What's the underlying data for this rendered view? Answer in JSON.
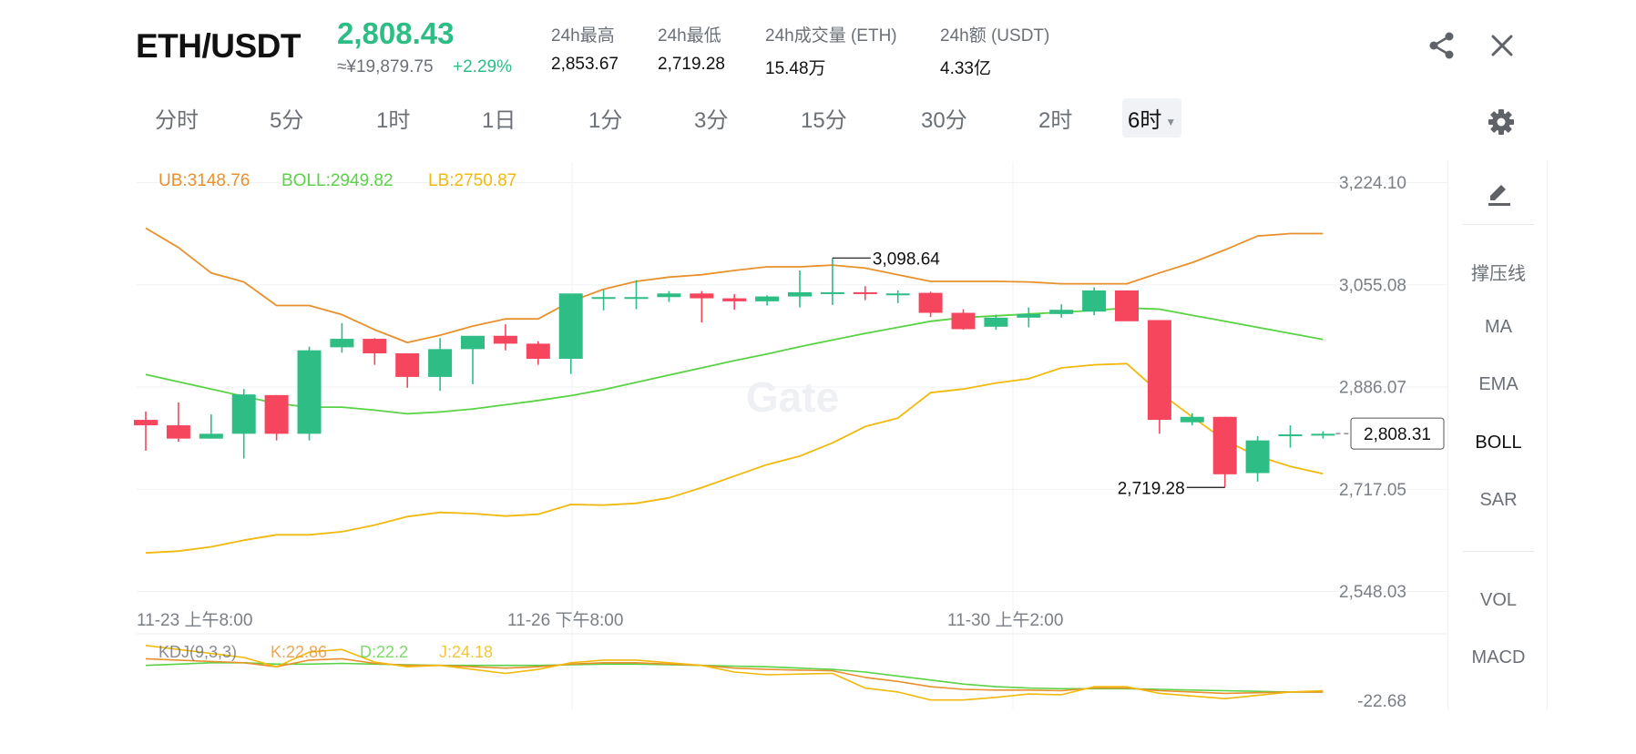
{
  "header": {
    "pair": "ETH/USDT",
    "price": "2,808.43",
    "price_cny": "≈¥19,879.75",
    "change": "+2.29%",
    "stats": [
      {
        "label": "24h最高",
        "value": "2,853.67"
      },
      {
        "label": "24h最低",
        "value": "2,719.28"
      },
      {
        "label": "24h成交量 (ETH)",
        "value": "15.48万"
      },
      {
        "label": "24h额 (USDT)",
        "value": "4.33亿"
      }
    ],
    "share_icon": "share-icon",
    "close_icon": "close-icon"
  },
  "timeframes": [
    "分时",
    "5分",
    "1时",
    "1日",
    "1分",
    "3分",
    "15分",
    "30分",
    "2时",
    "6时"
  ],
  "active_timeframe": "6时",
  "settings_icon": "gear-icon",
  "indicator_legend": {
    "ub": "UB:3148.76",
    "boll": "BOLL:2949.82",
    "lb": "LB:2750.87"
  },
  "kdj_legend": {
    "name": "KDJ(9,3,3)",
    "k": "K:22.86",
    "d": "D:22.2",
    "j": "J:24.18"
  },
  "sidebar": {
    "draw_icon": "pencil-icon",
    "items": [
      "撑压线",
      "MA",
      "EMA",
      "BOLL",
      "SAR"
    ],
    "active": "BOLL",
    "sub_items": [
      "VOL",
      "MACD"
    ]
  },
  "colors": {
    "up": "#2dbd85",
    "down": "#f6465d",
    "ub": "#e8912c",
    "boll": "#59d245",
    "lb": "#f0b90b",
    "kdj_k": "#e8912c",
    "kdj_d": "#59d245",
    "kdj_j": "#f0b90b"
  },
  "chart_data": {
    "type": "candlestick",
    "y_ticks": [
      "3,224.10",
      "3,055.08",
      "2,886.07",
      "2,717.05",
      "2,548.03"
    ],
    "ylim": [
      2548.03,
      3224.1
    ],
    "x_tick_labels": [
      "11-23 上午8:00",
      "11-26 下午8:00",
      "11-30 上午2:00"
    ],
    "last_price_label": "2,808.31",
    "last_price": 2808.31,
    "high_marker": {
      "label": "3,098.64",
      "value": 3098.64
    },
    "low_marker": {
      "label": "2,719.28",
      "value": 2719.28
    },
    "kdj_axis_label": "-22.68",
    "candles": [
      {
        "o": 2831,
        "h": 2845,
        "l": 2780,
        "c": 2822
      },
      {
        "o": 2822,
        "h": 2860,
        "l": 2795,
        "c": 2800
      },
      {
        "o": 2800,
        "h": 2840,
        "l": 2800,
        "c": 2808
      },
      {
        "o": 2808,
        "h": 2882,
        "l": 2767,
        "c": 2873
      },
      {
        "o": 2872,
        "h": 2872,
        "l": 2797,
        "c": 2808
      },
      {
        "o": 2808,
        "h": 2952,
        "l": 2797,
        "c": 2946
      },
      {
        "o": 2951,
        "h": 2991,
        "l": 2942,
        "c": 2965
      },
      {
        "o": 2965,
        "h": 2966,
        "l": 2922,
        "c": 2941
      },
      {
        "o": 2941,
        "h": 2941,
        "l": 2884,
        "c": 2902
      },
      {
        "o": 2902,
        "h": 2966,
        "l": 2879,
        "c": 2948
      },
      {
        "o": 2948,
        "h": 2966,
        "l": 2890,
        "c": 2970
      },
      {
        "o": 2970,
        "h": 2989,
        "l": 2946,
        "c": 2957
      },
      {
        "o": 2957,
        "h": 2961,
        "l": 2922,
        "c": 2932
      },
      {
        "o": 2932,
        "h": 3030,
        "l": 2907,
        "c": 3040
      },
      {
        "o": 3034,
        "h": 3046,
        "l": 3012,
        "c": 3034
      },
      {
        "o": 3034,
        "h": 3062,
        "l": 3014,
        "c": 3034
      },
      {
        "o": 3034,
        "h": 3044,
        "l": 3026,
        "c": 3040
      },
      {
        "o": 3040,
        "h": 3044,
        "l": 2992,
        "c": 3032
      },
      {
        "o": 3032,
        "h": 3039,
        "l": 3013,
        "c": 3027
      },
      {
        "o": 3027,
        "h": 3037,
        "l": 3020,
        "c": 3035
      },
      {
        "o": 3035,
        "h": 3078,
        "l": 3017,
        "c": 3042
      },
      {
        "o": 3042,
        "h": 3098.64,
        "l": 3021,
        "c": 3042
      },
      {
        "o": 3042,
        "h": 3052,
        "l": 3029,
        "c": 3040
      },
      {
        "o": 3040,
        "h": 3045,
        "l": 3024,
        "c": 3040
      },
      {
        "o": 3041,
        "h": 3043,
        "l": 3001,
        "c": 3008
      },
      {
        "o": 3008,
        "h": 3014,
        "l": 2980,
        "c": 2981
      },
      {
        "o": 2985,
        "h": 3005,
        "l": 2980,
        "c": 3000
      },
      {
        "o": 3000,
        "h": 3017,
        "l": 2984,
        "c": 3006
      },
      {
        "o": 3006,
        "h": 3022,
        "l": 3000,
        "c": 3013
      },
      {
        "o": 3010,
        "h": 3050,
        "l": 3004,
        "c": 3045
      },
      {
        "o": 3045,
        "h": 3045,
        "l": 3000,
        "c": 2994
      },
      {
        "o": 2996,
        "h": 2996,
        "l": 2808,
        "c": 2831
      },
      {
        "o": 2827,
        "h": 2842,
        "l": 2822,
        "c": 2836
      },
      {
        "o": 2836,
        "h": 2836,
        "l": 2719.28,
        "c": 2741
      },
      {
        "o": 2743,
        "h": 2804,
        "l": 2729,
        "c": 2797
      },
      {
        "o": 2806,
        "h": 2822,
        "l": 2785,
        "c": 2807
      },
      {
        "o": 2806,
        "h": 2812,
        "l": 2800,
        "c": 2808
      }
    ],
    "ub": [
      3148,
      3116,
      3074,
      3059,
      3020,
      3020,
      3005,
      2980,
      2959,
      2971,
      2986,
      2998,
      2998,
      3027,
      3047,
      3060,
      3067,
      3071,
      3078,
      3084,
      3084,
      3087,
      3082,
      3071,
      3060,
      3060,
      3060,
      3059,
      3056,
      3056,
      3056,
      3074,
      3091,
      3112,
      3135,
      3139,
      3139
    ],
    "boll": [
      2906,
      2894,
      2882,
      2870,
      2858,
      2852,
      2852,
      2847,
      2841,
      2844,
      2849,
      2856,
      2863,
      2871,
      2881,
      2893,
      2905,
      2917,
      2929,
      2940,
      2952,
      2963,
      2974,
      2984,
      2994,
      3000,
      3003,
      3006,
      3009,
      3012,
      3016,
      3014,
      3004,
      2994,
      2984,
      2974,
      2964
    ],
    "lb": [
      2611,
      2614,
      2621,
      2632,
      2641,
      2641,
      2646,
      2657,
      2671,
      2678,
      2676,
      2672,
      2675,
      2691,
      2690,
      2693,
      2702,
      2719,
      2738,
      2757,
      2771,
      2793,
      2820,
      2834,
      2876,
      2882,
      2892,
      2899,
      2917,
      2922,
      2924,
      2876,
      2836,
      2797,
      2771,
      2754,
      2742
    ],
    "kdj_k": [
      72,
      70,
      68,
      66,
      60,
      70,
      72,
      65,
      62,
      62,
      60,
      58,
      60,
      64,
      66,
      66,
      64,
      62,
      58,
      56,
      55,
      54,
      44,
      38,
      30,
      26,
      25,
      25,
      24,
      28,
      28,
      24,
      22,
      20,
      21,
      22,
      22
    ],
    "kdj_d": [
      62,
      64,
      66,
      66,
      64,
      64,
      65,
      64,
      63,
      62,
      62,
      62,
      62,
      63,
      64,
      64,
      63,
      62,
      61,
      60,
      58,
      56,
      52,
      46,
      40,
      34,
      30,
      28,
      27,
      27,
      27,
      26,
      25,
      24,
      23,
      22,
      22
    ],
    "kdj_j": [
      92,
      86,
      80,
      74,
      60,
      82,
      86,
      67,
      60,
      62,
      56,
      50,
      56,
      66,
      70,
      70,
      66,
      62,
      52,
      48,
      49,
      50,
      28,
      22,
      10,
      10,
      14,
      19,
      18,
      30,
      30,
      20,
      16,
      12,
      17,
      22,
      24
    ]
  }
}
